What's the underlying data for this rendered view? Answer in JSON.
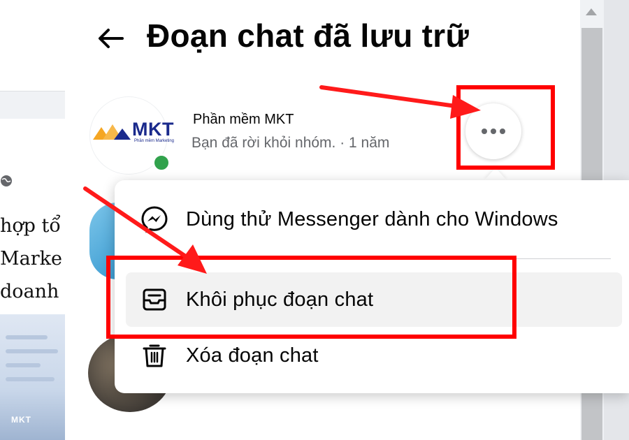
{
  "panel": {
    "title": "Đoạn chat đã lưu trữ",
    "back_icon": "arrow-left-icon"
  },
  "chat": {
    "name": "Phần mềm MKT",
    "preview": "Bạn đã rời khỏi nhóm. · 1 năm",
    "avatar_logo_text": "MKT",
    "avatar_logo_sub": "Phần mềm Marketing",
    "more_icon": "more-options-icon"
  },
  "menu": {
    "items": [
      {
        "label": "Dùng thử Messenger dành cho Windows",
        "icon": "messenger-icon"
      },
      {
        "label": "Khôi phục đoạn chat",
        "icon": "unarchive-icon"
      },
      {
        "label": "Xóa đoạn chat",
        "icon": "trash-icon"
      }
    ]
  },
  "background": {
    "article_lines": [
      "hợp tổ",
      "Marke",
      "doanh"
    ],
    "watermark": "MKT"
  },
  "colors": {
    "highlight": "#ff0000",
    "online": "#31a24c",
    "secondary_text": "#65676b",
    "logo_blue": "#1a2a8c",
    "logo_orange": "#f5a623"
  }
}
